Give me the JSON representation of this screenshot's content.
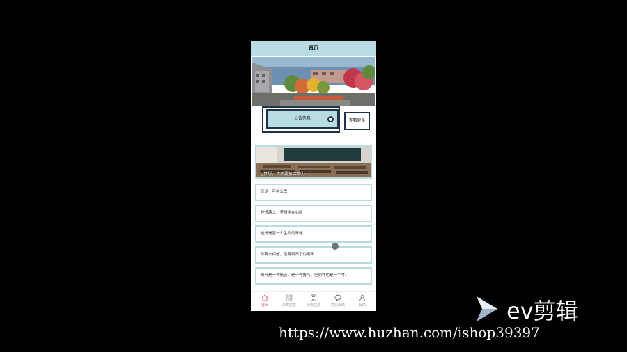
{
  "header": {
    "title": "首页"
  },
  "notice": {
    "label": "公告信息",
    "more_label": "查看更多"
  },
  "feature": {
    "caption": "为梦想，请不要放弃努力"
  },
  "list_items": [
    "又是一年毕业季",
    "挫折路上，坚持常在心间",
    "挫折是另一个生命的开端",
    "你要去相信，没有到不了的明天",
    "离开是一种痛苦，是一种勇气，但同样也是一个考..."
  ],
  "tabbar": {
    "active_index": 0,
    "tabs": [
      {
        "label": "首页",
        "icon": "home-icon"
      },
      {
        "label": "公寓信息",
        "icon": "grid-icon"
      },
      {
        "label": "公告信息",
        "icon": "document-icon"
      },
      {
        "label": "意见反馈",
        "icon": "chat-bubble-icon"
      },
      {
        "label": "我的",
        "icon": "user-icon"
      }
    ]
  },
  "watermark": {
    "brand": "ev剪辑",
    "url": "https://www.huzhan.com/ishop39397"
  },
  "colors": {
    "accent": "#b9dbe2",
    "border_dark": "#23324b",
    "active_tab": "#e2627b"
  }
}
